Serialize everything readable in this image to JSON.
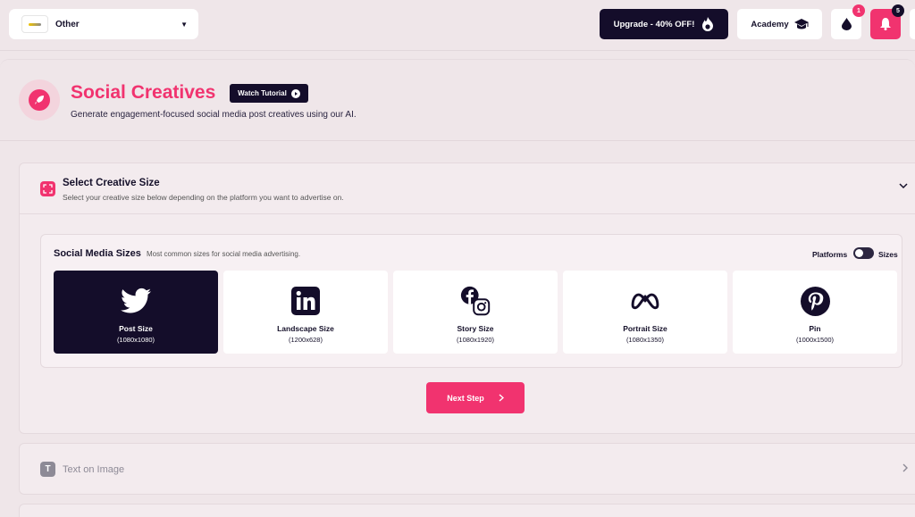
{
  "topbar": {
    "workspace_name": "Other",
    "upgrade_label": "Upgrade - 40% OFF!",
    "academy_label": "Academy",
    "drops_badge": "1",
    "notifications_badge": "5"
  },
  "header": {
    "title": "Social Creatives",
    "tutorial_label": "Watch Tutorial",
    "subtitle": "Generate engagement-focused social media post creatives using our AI."
  },
  "section_size": {
    "title": "Select Creative Size",
    "subtitle": "Select your creative size below depending on the platform you want to advertise on.",
    "card_title": "Social Media Sizes",
    "card_subtitle": "Most common sizes for social media advertising.",
    "toggle_left": "Platforms",
    "toggle_right": "Sizes",
    "tiles": [
      {
        "name": "Post Size",
        "dims": "(1080x1080)",
        "icon": "twitter-icon"
      },
      {
        "name": "Landscape Size",
        "dims": "(1200x628)",
        "icon": "linkedin-icon"
      },
      {
        "name": "Story Size",
        "dims": "(1080x1920)",
        "icon": "facebook-instagram-icon"
      },
      {
        "name": "Portrait Size",
        "dims": "(1080x1350)",
        "icon": "meta-icon"
      },
      {
        "name": "Pin",
        "dims": "(1000x1500)",
        "icon": "pinterest-icon"
      }
    ],
    "next_label": "Next Step"
  },
  "section_text": {
    "icon_letter": "T",
    "title": "Text on Image"
  },
  "colors": {
    "accent": "#f1336f",
    "dark": "#140d2a",
    "background": "#efe6e9"
  }
}
